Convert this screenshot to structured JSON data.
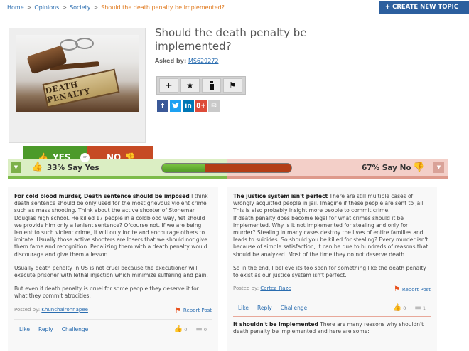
{
  "breadcrumb": {
    "home": "Home",
    "opinions": "Opinions",
    "society": "Society",
    "current": "Should the death penalty be implemented?",
    "sep": ">"
  },
  "header": {
    "create_label": "+ CREATE NEW TOPIC"
  },
  "topic": {
    "title": "Should the death penalty be implemented?",
    "asked_label": "Asked by:",
    "asked_user": "MS629272",
    "image_text": "DEATH PENALTY"
  },
  "vote": {
    "yes_label": "YES",
    "or_label": "or",
    "no_label": "NO"
  },
  "actions": {
    "add": "+",
    "star": "★",
    "flag": "⚑"
  },
  "share": {
    "facebook": "f",
    "twitter": "t",
    "linkedin": "in",
    "googleplus": "8+",
    "email": "✉",
    "colors": {
      "facebook": "#3b5998",
      "twitter": "#1da1f2",
      "linkedin": "#0077b5",
      "googleplus": "#dd4b39",
      "email": "#c9c9c9"
    }
  },
  "stats": {
    "yes_text": "33% Say Yes",
    "no_text": "67% Say No",
    "yes_fraction": 0.33
  },
  "posts_yes": [
    {
      "headline": "For cold blood murder, Death sentence should be imposed",
      "body": "I think death sentence should be only used for the most grievous violent crime such as mass shooting. Think about the active shooter of Stoneman Douglas high school. He killed 17 people in a coldblood way, Yet should we provide him only a lenient sentence? Ofcourse not. If we are being lenient to such violent crime, It will only incite and encourage others to imitate. Usually those active shooters are losers that we should not give them fame and recognition. Penalizing them with a death penalty would discourage and give them a lesson.",
      "para2": "Usually death penalty in US is not cruel because the executioner will execute prisoner with lethal injection which minimize suffering and pain.",
      "para3": "But even if death penalty is cruel for some people they deserve it for what they commit atrocities.",
      "posted_label": "Posted by:",
      "author": "Khunchaironnapee",
      "report": "Report Post",
      "like": "Like",
      "reply": "Reply",
      "challenge": "Challenge",
      "likes": "0",
      "comments": "0"
    }
  ],
  "posts_no": [
    {
      "headline": "The justice system isn't perfect",
      "body": "There are still multiple cases of wrongly acquitted people in jail. Imagine if these people are sent to jail. This is also probably insight more people to commit crime.",
      "para2": "If death penalty does become legal for what crimes should it be implemented. Why is it not implemented for stealing and only for murder? Stealing in many cases destroy the lives of entire families and leads to suicides. So should you be killed for stealing? Every murder isn't because of simple satisfaction, It can be due to hundreds of reasons that should be analyzed. Most of the time they do not deserve death.",
      "para3": "So in the end, I believe its too soon for something like the death penalty to exist as our justice system isn't perfect.",
      "posted_label": "Posted by:",
      "author": "Cartez_Raze",
      "report": "Report Post",
      "like": "Like",
      "reply": "Reply",
      "challenge": "Challenge",
      "likes": "0",
      "comments": "1"
    },
    {
      "headline": "It shouldn't be implemented",
      "body": "There are many reasons why shouldn't death penalty be implemented and here are some:"
    }
  ]
}
